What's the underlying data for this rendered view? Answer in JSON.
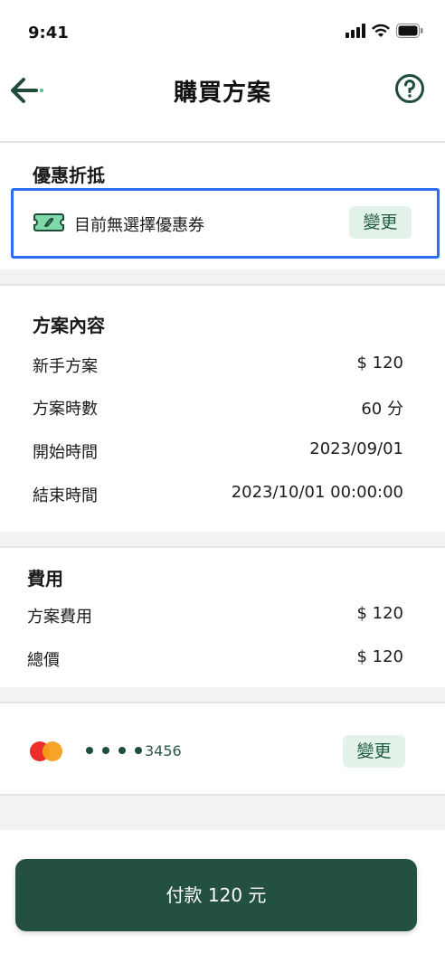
{
  "status_bar": {
    "time": "9:41"
  },
  "header": {
    "title": "購買方案"
  },
  "discount": {
    "title": "優惠折抵",
    "coupon_text": "目前無選擇優惠券",
    "change_label": "變更"
  },
  "plan": {
    "title": "方案內容",
    "rows": [
      {
        "label": "新手方案",
        "value": "$ 120"
      },
      {
        "label": "方案時數",
        "value": "60 分"
      },
      {
        "label": "開始時間",
        "value": "2023/09/01"
      },
      {
        "label": "結束時間",
        "value": "2023/10/01 00:00:00"
      }
    ]
  },
  "fees": {
    "title": "費用",
    "rows": [
      {
        "label": "方案費用",
        "value": "$ 120"
      },
      {
        "label": "總價",
        "value": "$ 120"
      }
    ]
  },
  "payment": {
    "card_digits": "3456",
    "change_label": "變更"
  },
  "pay_button": {
    "label": "付款 120 元"
  },
  "colors": {
    "primary": "#24503f",
    "accent_bg": "#e3f3ea",
    "highlight_border": "#2d6df0",
    "mastercard_red": "#eb2d2d",
    "mastercard_orange": "#f79e1b"
  }
}
